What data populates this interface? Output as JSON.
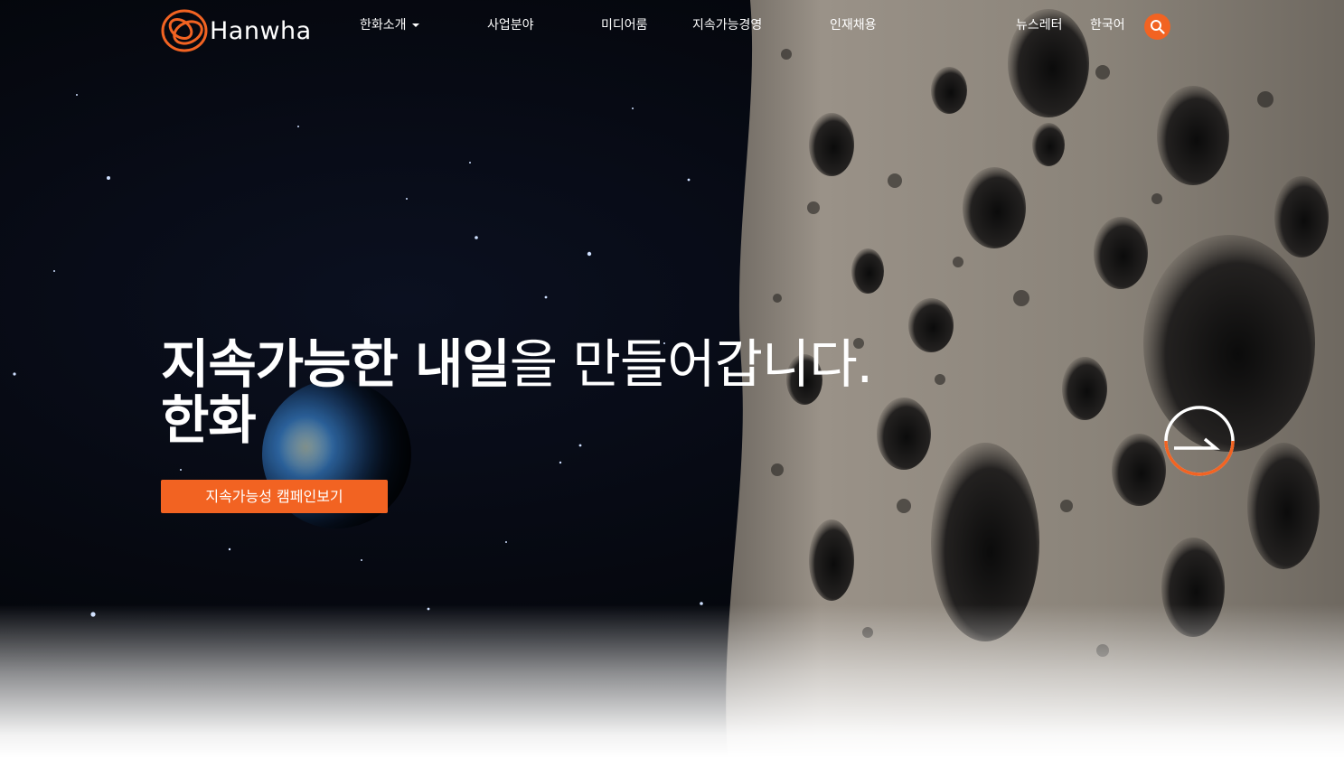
{
  "header": {
    "logo_text": "Hanwha",
    "nav": [
      {
        "label": "한화소개",
        "has_dropdown": true
      },
      {
        "label": "사업분야"
      },
      {
        "label": "미디어룸"
      },
      {
        "label": "지속가능경영"
      },
      {
        "label": "인재채용"
      }
    ],
    "utility": {
      "newsletter": "뉴스레터",
      "language": "한국어"
    },
    "search_icon": "search-icon"
  },
  "hero": {
    "headline_bold": "지속가능한 내일",
    "headline_light": "을 만들어갑니다.",
    "headline_line2": "한화",
    "cta_label": "지속가능성 캠페인보기",
    "next_icon": "arrow-right-circle-icon"
  },
  "colors": {
    "accent": "#f26322",
    "text": "#ffffff",
    "background": "#05070d"
  }
}
